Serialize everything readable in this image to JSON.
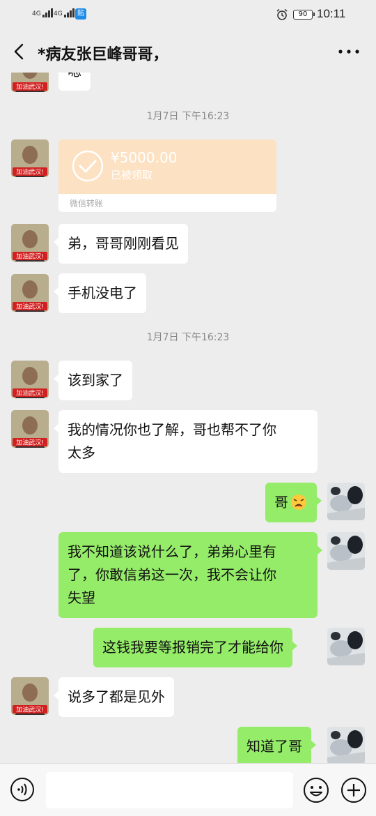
{
  "status_bar": {
    "signal1": "4G",
    "signal2": "4G",
    "app_badge": "贴",
    "battery": "90",
    "time": "10:11"
  },
  "header": {
    "title": "*病友张巨峰哥哥，"
  },
  "avatar_left_caption": "加油武汉!",
  "messages": {
    "m0": "嗯",
    "ts1": "1月7日 下午16:23",
    "transfer_amount": "¥5000.00",
    "transfer_status": "已被领取",
    "transfer_label": "微信转账",
    "m1": "弟，哥哥刚刚看见",
    "m2": "手机没电了",
    "ts2": "1月7日 下午16:23",
    "m3": "该到家了",
    "m4_l1": "我的情况你也了解，哥也帮不了你",
    "m4_l2": "太多",
    "m5": "哥",
    "m6_l1": "我不知道该说什么了，弟弟心里有",
    "m6_l2": "了，你敢信弟这一次，我不会让你",
    "m6_l3": "失望",
    "m7": "这钱我要等报销完了才能给你",
    "m8": "说多了都是见外",
    "m9": "知道了哥"
  },
  "colors": {
    "background": "#ededed",
    "bubble_in": "#ffffff",
    "bubble_out": "#95ec69",
    "transfer_card": "#fde1c3",
    "timestamp": "#888888"
  },
  "icons": [
    "back-arrow-icon",
    "more-dots-icon",
    "voice-icon",
    "emoji-icon",
    "plus-icon",
    "alarm-icon",
    "check-circle-icon",
    "persevering-face-emoji"
  ]
}
